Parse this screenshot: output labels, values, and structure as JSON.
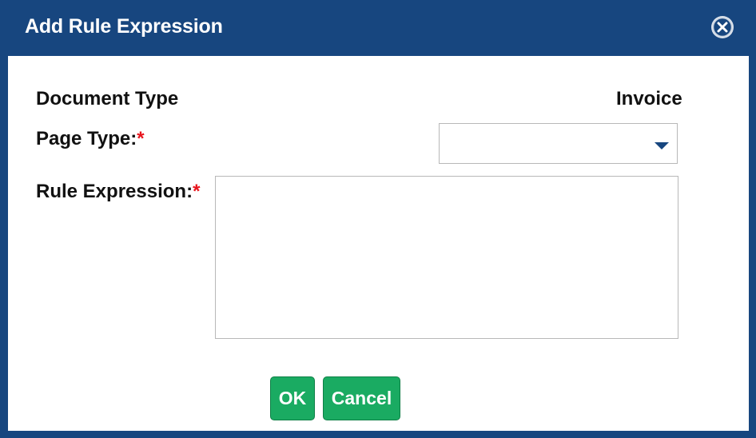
{
  "dialog": {
    "title": "Add Rule Expression",
    "close_icon": "close-circle-icon",
    "colors": {
      "header": "#17467f",
      "button": "#1aab62",
      "required": "#e8141c"
    }
  },
  "form": {
    "document_type_label": "Document Type",
    "document_type_value": "Invoice",
    "page_type_label": "Page Type:",
    "page_type_value": "",
    "rule_expression_label": "Rule Expression:",
    "rule_expression_value": "",
    "required_marker": "*",
    "dropdown_icon": "caret-down-icon"
  },
  "buttons": {
    "ok_label": "OK",
    "cancel_label": "Cancel"
  }
}
